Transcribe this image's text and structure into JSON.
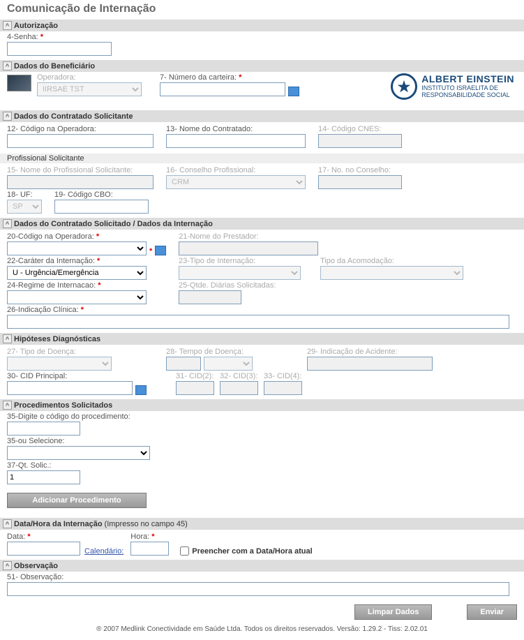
{
  "page_title": "Comunicação de Internação",
  "sections": {
    "autorizacao": {
      "title": "Autorização",
      "senha_label": "4-Senha:"
    },
    "beneficiario": {
      "title": "Dados do Beneficiário",
      "operadora_label": "Operadora:",
      "operadora_value": "IIRSAE TST",
      "carteira_label": "7- Número da carteira:"
    },
    "logo": {
      "name": "ALBERT EINSTEIN",
      "line2": "INSTITUTO ISRAELITA DE",
      "line3": "RESPONSABILIDADE SOCIAL"
    },
    "solicitante": {
      "title": "Dados do Contratado Solicitante",
      "codigo_op": "12- Código na Operadora:",
      "nome_cont": "13- Nome do Contratado:",
      "codigo_cnes": "14- Código CNES:",
      "prof_header": "Profissional Solicitante",
      "nome_prof": "15- Nome do Profissional Solicitante:",
      "conselho": "16- Conselho Profissional:",
      "conselho_value": "CRM",
      "no_conselho": "17- No. no Conselho:",
      "uf": "18- UF:",
      "uf_value": "SP",
      "cbo": "19- Código CBO:"
    },
    "internacao": {
      "title": "Dados do Contratado Solicitado / Dados da Internação",
      "codigo_op": "20-Código na Operadora:",
      "nome_prest": "21-Nome do Prestador:",
      "carater": "22-Caráter da Internação:",
      "carater_value": "U - Urgência/Emergência",
      "tipo_int": "23-Tipo de Internação:",
      "tipo_acom": "Tipo da Acomodação:",
      "regime": "24-Regime de Internacao:",
      "qtde_diarias": "25-Qtde. Diárias Solicitadas:",
      "indicacao": "26-Indicação Clínica:"
    },
    "hipoteses": {
      "title": "Hipóteses Diagnósticas",
      "tipo_doenca": "27- Tipo de Doença:",
      "tempo_doenca": "28- Tempo de Doença:",
      "indic_acidente": "29- Indicação de Acidente:",
      "cid_principal": "30- CID Principal:",
      "cid2": "31- CID(2):",
      "cid3": "32- CID(3):",
      "cid4": "33- CID(4):"
    },
    "procedimentos": {
      "title": "Procedimentos Solicitados",
      "digite": "35-Digite o código do procedimento:",
      "selecione": "35-ou Selecione:",
      "qt": "37-Qt. Solic.:",
      "qt_value": "1",
      "btn_add": "Adicionar Procedimento"
    },
    "datahora": {
      "title": "Data/Hora da Internação",
      "suffix": "(Impresso no campo 45)",
      "data": "Data:",
      "calendario": "Calendário:",
      "hora": "Hora:",
      "preencher": "Preencher com a Data/Hora atual"
    },
    "observacao": {
      "title": "Observação",
      "obs": "51- Observação:"
    }
  },
  "buttons": {
    "limpar": "Limpar Dados",
    "enviar": "Enviar"
  },
  "footer": "® 2007  Medlink Conectividade em Saúde Ltda.   Todos os direitos reservados.   Versão: 1.29.2 - Tiss: 2.02.01"
}
